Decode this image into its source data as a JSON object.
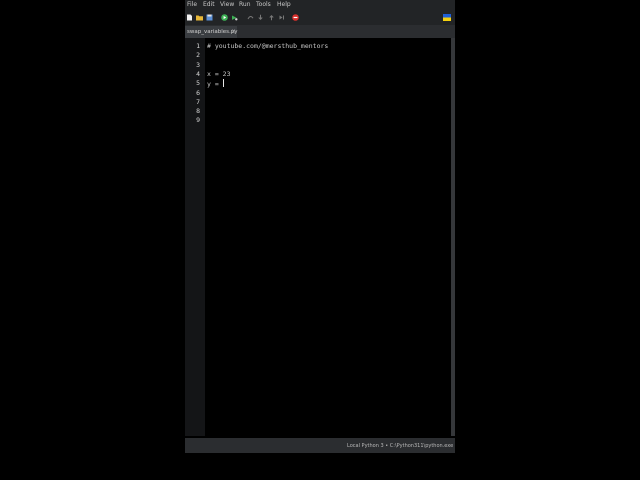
{
  "menubar": {
    "items": [
      "File",
      "Edit",
      "View",
      "Run",
      "Tools",
      "Help"
    ]
  },
  "toolbar": {
    "icons": [
      "new-file-icon",
      "open-folder-icon",
      "save-icon",
      "run-icon",
      "debug-icon",
      "step-over-icon",
      "step-into-icon",
      "step-out-icon",
      "resume-icon",
      "stop-icon"
    ],
    "flag_icon": "ukraine-flag-icon"
  },
  "tab": {
    "label": "swap_variables.py",
    "close": "×"
  },
  "editor": {
    "line_numbers": [
      "1",
      "2",
      "3",
      "4",
      "5",
      "6",
      "7",
      "8",
      "9"
    ],
    "lines": [
      "# youtube.com/@mersthub_mentors",
      "",
      "",
      "x = 23",
      "y = ",
      "",
      "",
      "",
      ""
    ]
  },
  "status": {
    "interpreter": "Local Python 3  •  C:\\Python311\\python.exe"
  },
  "colors": {
    "stop": "#d9302c",
    "run": "#3cb054",
    "flag_blue": "#1f5fd6",
    "flag_yellow": "#f5d10f"
  }
}
